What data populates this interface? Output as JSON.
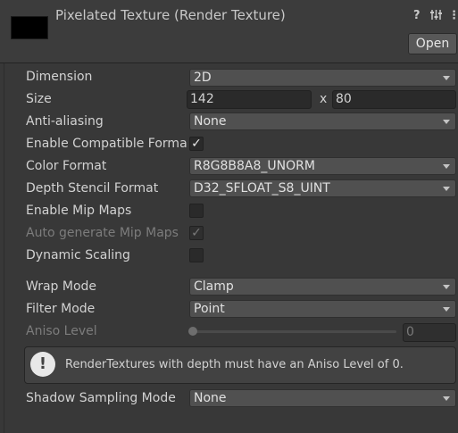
{
  "header": {
    "title": "Pixelated Texture (Render Texture)",
    "open_label": "Open",
    "icons": [
      "help-icon",
      "settings-sliders-icon",
      "more-options-icon"
    ]
  },
  "fields": {
    "dimension": {
      "label": "Dimension",
      "value": "2D"
    },
    "size": {
      "label": "Size",
      "width": "142",
      "x_sep": "x",
      "height": "80"
    },
    "anti_aliasing": {
      "label": "Anti-aliasing",
      "value": "None"
    },
    "enable_compat": {
      "label": "Enable Compatible Format",
      "checked": true
    },
    "color_format": {
      "label": "Color Format",
      "value": "R8G8B8A8_UNORM"
    },
    "depth_stencil": {
      "label": "Depth Stencil Format",
      "value": "D32_SFLOAT_S8_UINT"
    },
    "enable_mip": {
      "label": "Enable Mip Maps",
      "checked": false
    },
    "auto_mip": {
      "label": "Auto generate Mip Maps",
      "checked": true,
      "disabled": true
    },
    "dynamic_scaling": {
      "label": "Dynamic Scaling",
      "checked": false
    },
    "wrap_mode": {
      "label": "Wrap Mode",
      "value": "Clamp"
    },
    "filter_mode": {
      "label": "Filter Mode",
      "value": "Point"
    },
    "aniso_level": {
      "label": "Aniso Level",
      "value": "0",
      "slider_fraction": 0.0,
      "disabled": true
    },
    "shadow_sampling": {
      "label": "Shadow Sampling Mode",
      "value": "None"
    }
  },
  "warning": {
    "icon": "!",
    "text": "RenderTextures with depth must have an Aniso Level of 0."
  },
  "check_glyph": "✓"
}
